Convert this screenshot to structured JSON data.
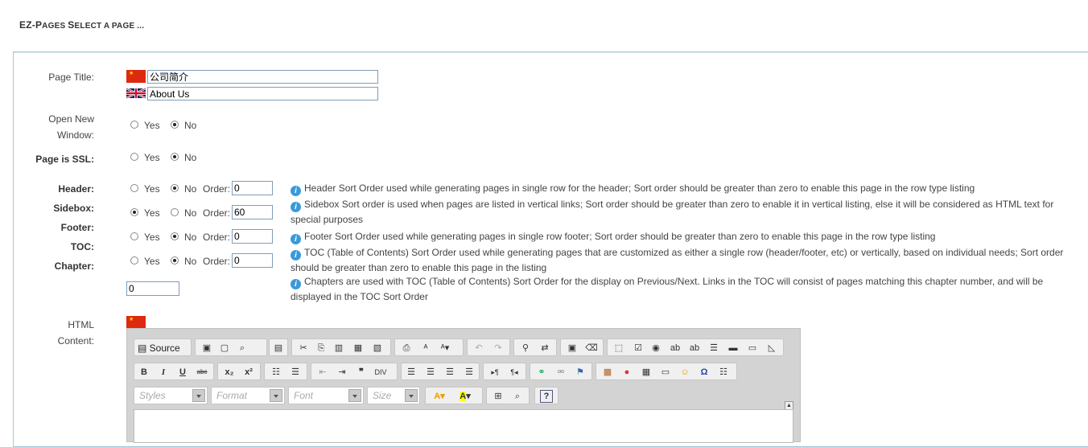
{
  "heading": {
    "e": "E",
    "z": "Z-",
    "p": "P",
    "ages": "AGES ",
    "s": "S",
    "elect": "ELECT A PAGE ..."
  },
  "labels": {
    "page_title": "Page Title:",
    "open_new_1": "Open New",
    "open_new_2": "Window:",
    "ssl": "Page is SSL:",
    "header": "Header:",
    "sidebox": "Sidebox:",
    "footer": "Footer:",
    "toc": "TOC:",
    "chapter": "Chapter:",
    "html_1": "HTML",
    "html_2": "Content:"
  },
  "title_cn": "公司简介",
  "title_en": "About Us",
  "yes": "Yes",
  "no": "No",
  "order": "Order:",
  "orders": {
    "header": "0",
    "sidebox": "60",
    "footer": "0",
    "chapter": "0",
    "toc": "0"
  },
  "help": {
    "header": "Header Sort Order used while generating pages in single row for the header; Sort order should be greater than zero to enable this page in the row type listing",
    "sidebox": "Sidebox Sort order is used when pages are listed in vertical links; Sort order should be greater than zero to enable it in vertical listing, else it will be considered as HTML text for special purposes",
    "footer": "Footer Sort Order used while generating pages in single row footer; Sort order should be greater than zero to enable this page in the row type listing",
    "toc": "TOC (Table of Contents) Sort Order used while generating pages that are customized as either a single row (header/footer, etc) or vertically, based on individual needs; Sort order should be greater than zero to enable this page in the listing",
    "chapter": "Chapters are used with TOC (Table of Contents) Sort Order for the display on Previous/Next. Links in the TOC will consist of pages matching this chapter number, and will be displayed in the TOC Sort Order"
  },
  "editor": {
    "source": "Source",
    "styles": "Styles",
    "format": "Format",
    "font": "Font",
    "size": "Size"
  }
}
